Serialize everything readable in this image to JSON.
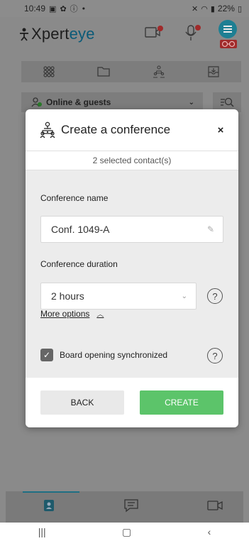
{
  "status_bar": {
    "time": "10:49",
    "battery_text": "22%",
    "left_icons": [
      "image-notification-icon",
      "accessibility-icon",
      "info-icon",
      "dot-icon"
    ],
    "right_icons": [
      "mute-icon",
      "wifi-icon",
      "signal-icon",
      "battery-icon"
    ]
  },
  "header": {
    "logo_text_main": "Xpert",
    "logo_text_accent": "eye",
    "icons": [
      "camera-off-icon",
      "mic-off-icon",
      "menu-icon",
      "glasses-icon"
    ]
  },
  "toolbar": {
    "icons": [
      "grid-icon",
      "folder-icon",
      "group-icon",
      "inbox-icon"
    ]
  },
  "filter": {
    "selected": "Online & guests",
    "search_icon": "filter-search-icon"
  },
  "dialog": {
    "title": "Create a conference",
    "close_label": "×",
    "subtitle": "2 selected contact(s)",
    "name_label": "Conference name",
    "name_value": "Conf. 1049-A",
    "duration_label": "Conference duration",
    "duration_value": "2 hours",
    "help_label": "?",
    "more_options_label": "More options",
    "checkbox_label": "Board opening synchronized",
    "checkbox_checked": true,
    "back_label": "BACK",
    "create_label": "CREATE"
  },
  "bottom_tabs": {
    "items": [
      "contacts-tab-icon",
      "chat-tab-icon",
      "video-tab-icon"
    ]
  },
  "colors": {
    "accent": "#1e7f93",
    "create_button": "#5cc46a",
    "overlay": "#8a8a8a"
  }
}
